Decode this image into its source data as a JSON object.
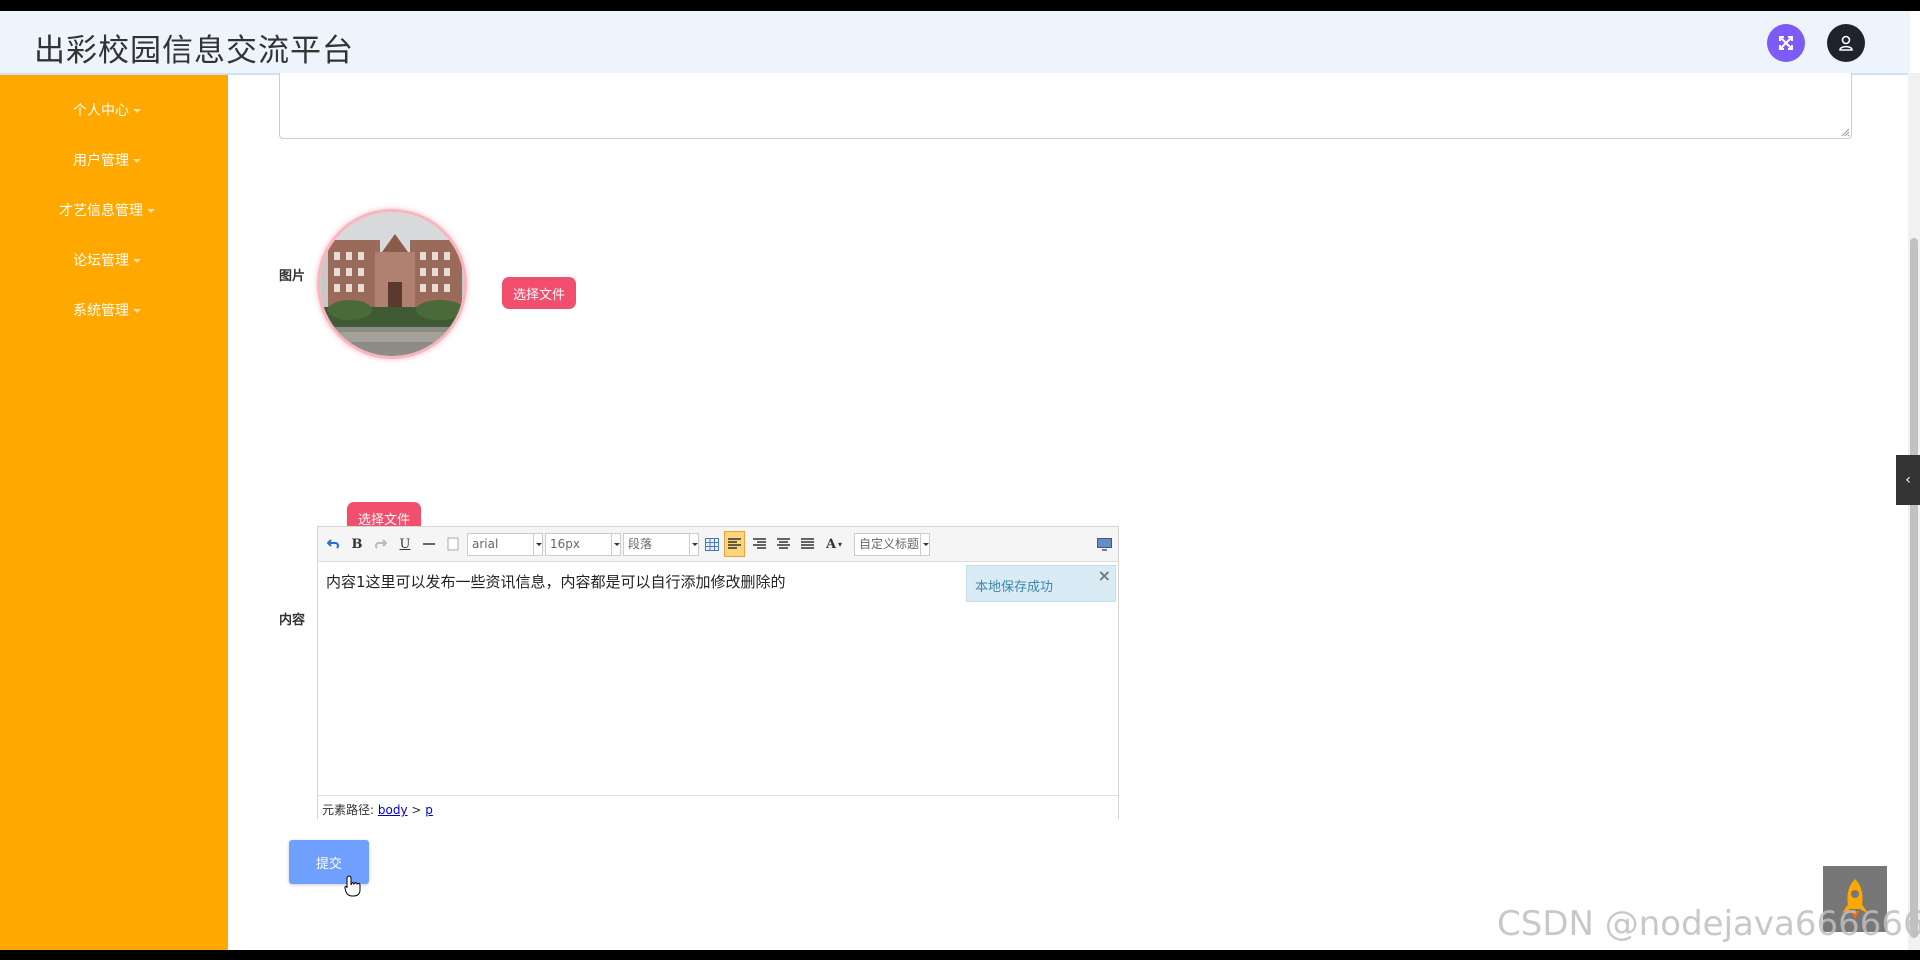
{
  "header": {
    "title": "出彩校园信息交流平台"
  },
  "sidebar": {
    "items": [
      {
        "label": "个人中心"
      },
      {
        "label": "用户管理"
      },
      {
        "label": "才艺信息管理"
      },
      {
        "label": "论坛管理"
      },
      {
        "label": "系统管理"
      }
    ]
  },
  "form": {
    "image_label": "图片",
    "image_button": "选择文件",
    "content_label": "内容",
    "content_button": "选择文件",
    "submit_label": "提交"
  },
  "editor": {
    "font_family": "arial",
    "font_size": "16px",
    "paragraph": "段落",
    "custom_title": "自定义标题",
    "content": "内容1这里可以发布一些资讯信息，内容都是可以自行添加修改删除的",
    "toast": "本地保存成功",
    "path_label": "元素路径:",
    "path_body": "body",
    "path_sep": ">",
    "path_p": "p"
  },
  "watermark": "CSDN @nodejava666666",
  "colors": {
    "sidebar": "#ffa800",
    "accent_pink": "#f24f6e",
    "submit": "#6fa0ff",
    "expand_button": "#7b5cf6"
  }
}
